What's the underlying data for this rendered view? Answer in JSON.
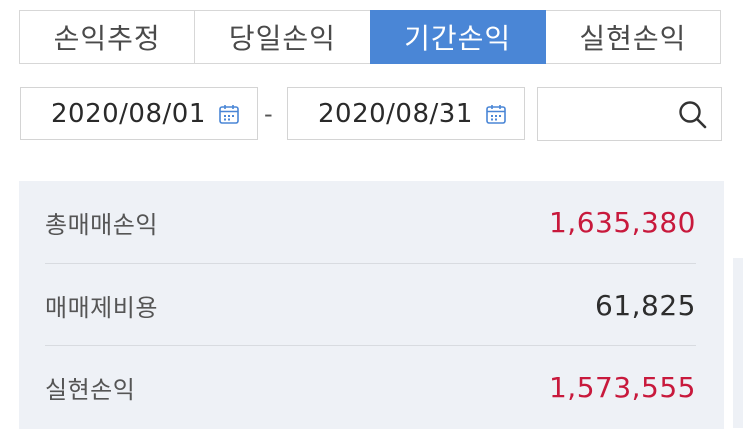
{
  "tabs": [
    {
      "label": "손익추정",
      "active": false
    },
    {
      "label": "당일손익",
      "active": false
    },
    {
      "label": "기간손익",
      "active": true
    },
    {
      "label": "실현손익",
      "active": false
    }
  ],
  "date_range": {
    "start": "2020/08/01",
    "separator": "-",
    "end": "2020/08/31"
  },
  "search": {
    "value": ""
  },
  "summary": [
    {
      "label": "총매매손익",
      "value": "1,635,380",
      "color": "#c8193c"
    },
    {
      "label": "매매제비용",
      "value": "61,825",
      "color": "#2d2d2d"
    },
    {
      "label": "실현손익",
      "value": "1,573,555",
      "color": "#c8193c"
    }
  ],
  "colors": {
    "accent": "#4a86d6",
    "profit": "#c8193c",
    "panel": "#eef1f6"
  },
  "icons": [
    "calendar-icon",
    "search-icon"
  ]
}
